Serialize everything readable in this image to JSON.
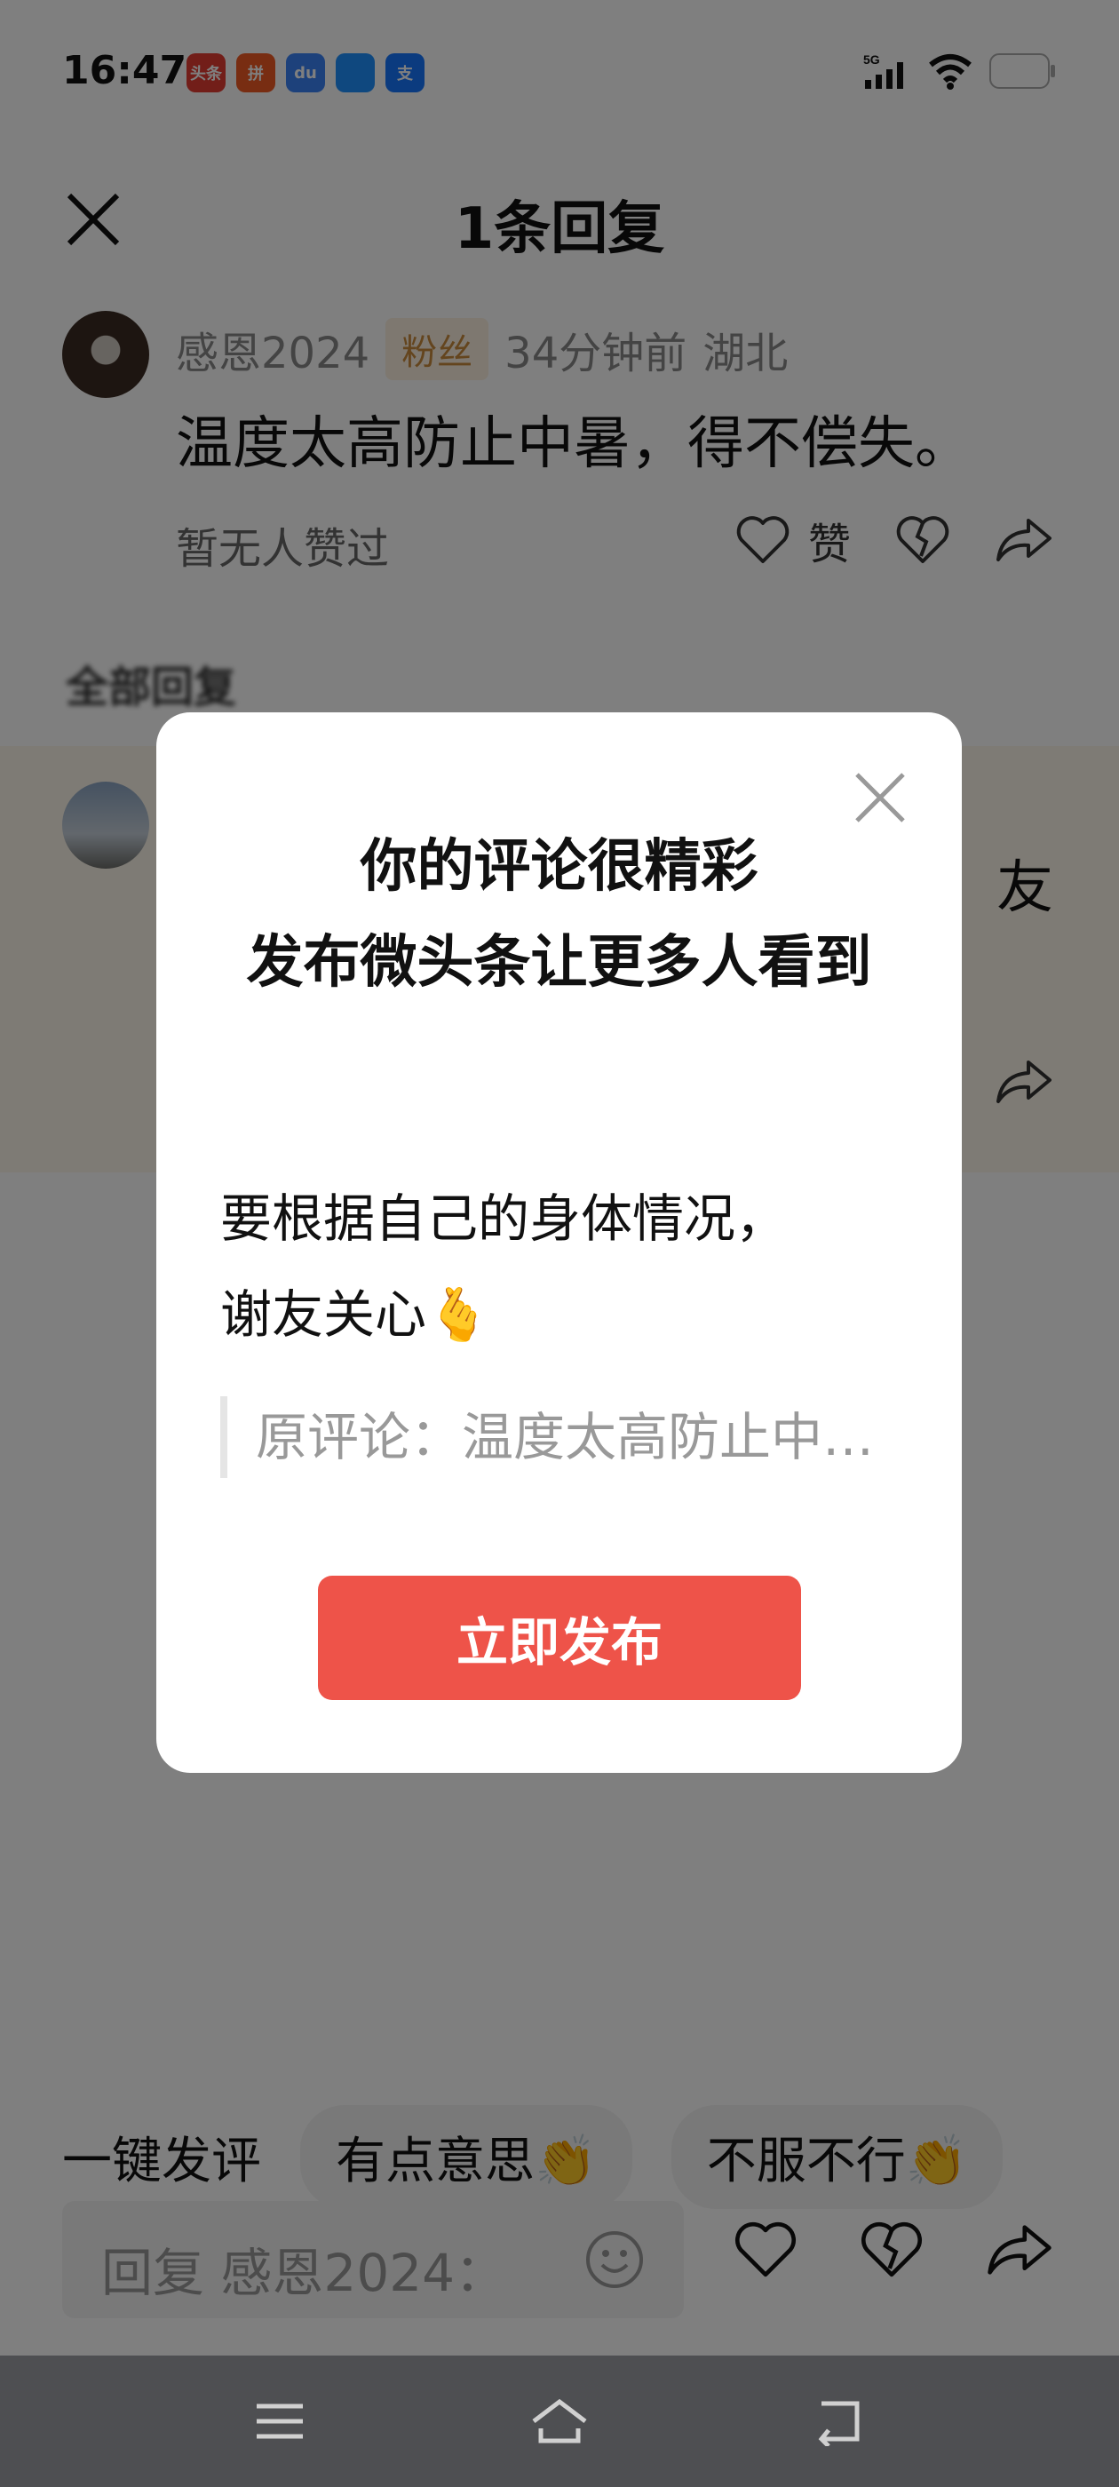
{
  "status_bar": {
    "time": "16:47",
    "network": "5G",
    "apps": [
      "头条",
      "拼",
      "du",
      "",
      "支"
    ]
  },
  "sheet": {
    "title": "1条回复",
    "comment": {
      "user": "感恩2024",
      "badge": "粉丝",
      "time_ago": "34分钟前",
      "location": "湖北",
      "text": "温度太高防止中暑，得不偿失。",
      "likes_status": "暂无人赞过",
      "like_label": "赞"
    },
    "all_replies_label": "全部回复",
    "reply_partial_text": "友"
  },
  "bottom": {
    "quick_label": "一键发评",
    "chips": [
      "有点意思👏",
      "不服不行👏"
    ],
    "reply_placeholder": "回复 感恩2024："
  },
  "modal": {
    "title_line1": "你的评论很精彩",
    "title_line2": "发布微头条让更多人看到",
    "body_line1": "要根据自己的身体情况，",
    "body_line2": "谢友关心🫰",
    "quote": "原评论：温度太高防止中暑，得不偿失。",
    "button": "立即发布"
  },
  "colors": {
    "accent": "#ee5349",
    "badge_bg": "#fdf1e0",
    "badge_text": "#c98a3c",
    "overlay": "rgba(0,0,0,0.5)"
  }
}
